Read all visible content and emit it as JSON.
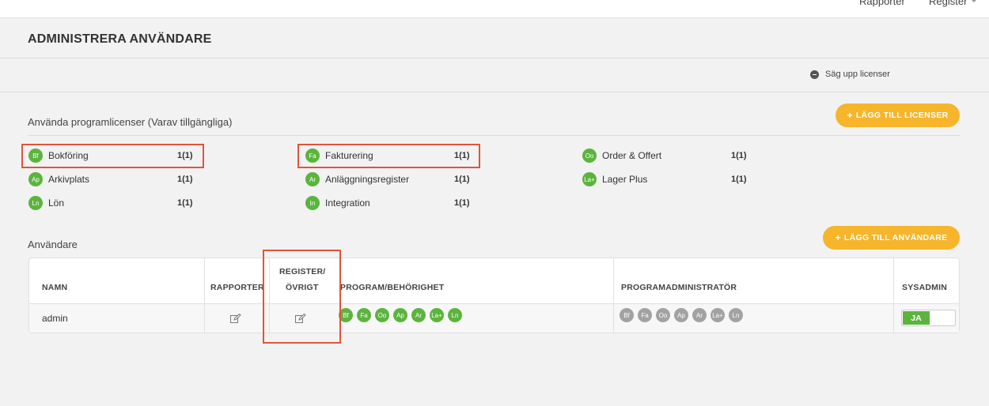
{
  "topnav": {
    "rapporter": "Rapporter",
    "register": "Register"
  },
  "page": {
    "title": "ADMINISTRERA ANVÄNDARE",
    "cancel_licenses": "Säg upp licenser"
  },
  "licenses": {
    "section_title": "Använda programlicenser (Varav tillgängliga)",
    "add_button": "LÄGG TILL LICENSER",
    "items": [
      {
        "abbr": "Bf",
        "name": "Bokföring",
        "count": "1(1)"
      },
      {
        "abbr": "Fa",
        "name": "Fakturering",
        "count": "1(1)"
      },
      {
        "abbr": "Oo",
        "name": "Order & Offert",
        "count": "1(1)"
      },
      {
        "abbr": "Ap",
        "name": "Arkivplats",
        "count": "1(1)"
      },
      {
        "abbr": "Ar",
        "name": "Anläggningsregister",
        "count": "1(1)"
      },
      {
        "abbr": "La+",
        "name": "Lager Plus",
        "count": "1(1)"
      },
      {
        "abbr": "Ln",
        "name": "Lön",
        "count": "1(1)"
      },
      {
        "abbr": "In",
        "name": "Integration",
        "count": "1(1)"
      }
    ]
  },
  "users": {
    "section_title": "Användare",
    "add_button": "LÄGG TILL ANVÄNDARE",
    "columns": {
      "name": "NAMN",
      "rapporter": "RAPPORTER",
      "register_line1": "REGISTER/",
      "register_line2": "ÖVRIGT",
      "program": "PROGRAM/BEHÖRIGHET",
      "programadmin": "PROGRAMADMINISTRATÖR",
      "sysadmin": "SYSADMIN"
    },
    "rows": [
      {
        "name": "admin",
        "program_badges": [
          "Bf",
          "Fa",
          "Oo",
          "Ap",
          "Ar",
          "La+",
          "Ln"
        ],
        "admin_badges": [
          "Bf",
          "Fa",
          "Oo",
          "Ap",
          "Ar",
          "La+",
          "Ln"
        ],
        "sysadmin": "JA"
      }
    ]
  },
  "colors": {
    "accent_yellow": "#f6b52a",
    "badge_green": "#5bb43d",
    "badge_grey": "#a2a2a2",
    "highlight_red": "#e0553b"
  },
  "icons": {
    "edit": "edit-icon",
    "minus": "minus-circle-icon",
    "plus": "plus-icon",
    "caret": "chevron-down-icon"
  }
}
